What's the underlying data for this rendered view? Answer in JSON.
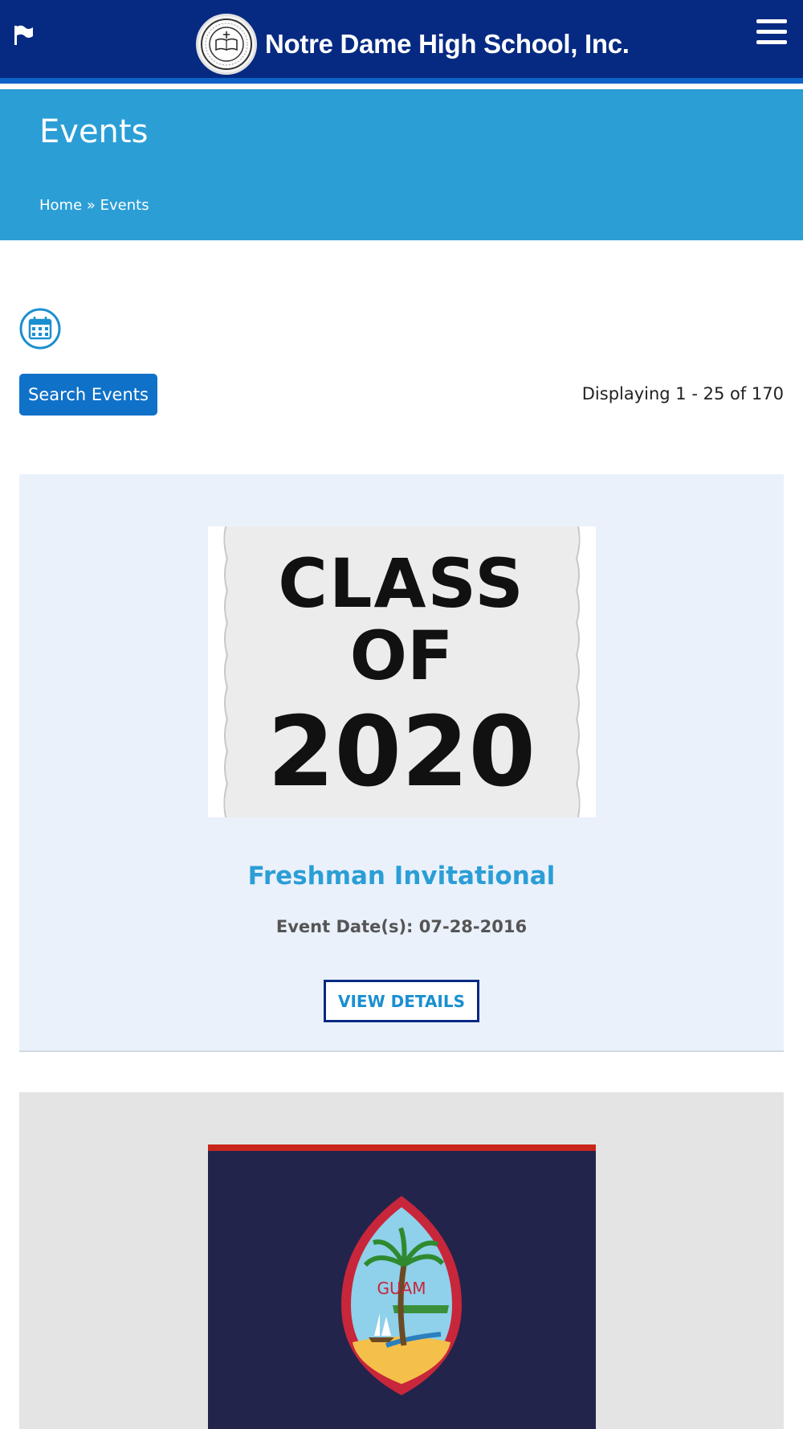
{
  "header": {
    "brand_name": "Notre Dame High School, Inc.",
    "flag_icon": "flag-icon",
    "menu_icon": "hamburger-menu-icon",
    "logo_icon": "school-seal-logo"
  },
  "banner": {
    "title": "Events",
    "breadcrumb": {
      "home": "Home",
      "separator": "»",
      "current": "Events"
    }
  },
  "toolbar": {
    "calendar_icon": "calendar-icon",
    "search_label": "Search Events",
    "displaying": "Displaying 1 - 25 of 170"
  },
  "events": [
    {
      "image_text": [
        "CLASS",
        "OF",
        "2020"
      ],
      "title": "Freshman Invitational",
      "date": "Event Date(s): 07-28-2016",
      "details_label": "VIEW DETAILS"
    },
    {
      "image_text": [
        "GUAM"
      ]
    }
  ],
  "colors": {
    "header_bg": "#062a82",
    "banner_bg": "#2b9ed6",
    "button_bg": "#0f71c8",
    "card_bg": "#eaf1fb",
    "accent_text": "#2b9ed6"
  }
}
